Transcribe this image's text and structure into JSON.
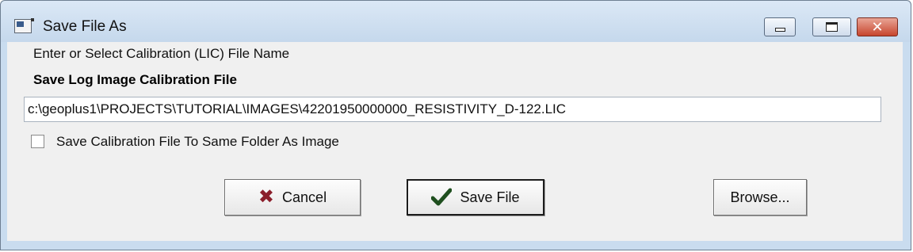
{
  "window": {
    "title": "Save File As",
    "controls": {
      "minimize": "minimize",
      "maximize": "maximize",
      "close": "✕"
    }
  },
  "form": {
    "prompt": "Enter or Select Calibration (LIC) File Name",
    "heading": "Save Log Image Calibration File",
    "file_path": "c:\\geoplus1\\PROJECTS\\TUTORIAL\\IMAGES\\42201950000000_RESISTIVITY_D-122.LIC",
    "same_folder_checkbox": {
      "label": "Save Calibration File To Same Folder As Image",
      "checked": false
    }
  },
  "buttons": {
    "cancel_label": "Cancel",
    "save_label": "Save File",
    "browse_label": "Browse..."
  },
  "icons": {
    "cancel": "x-mark-icon",
    "save": "checkmark-icon"
  },
  "colors": {
    "cancel_icon": "#8b1e2b",
    "save_icon": "#1f4f1f",
    "close_button": "#c7462e",
    "dialog_background": "#f0f0f0"
  }
}
